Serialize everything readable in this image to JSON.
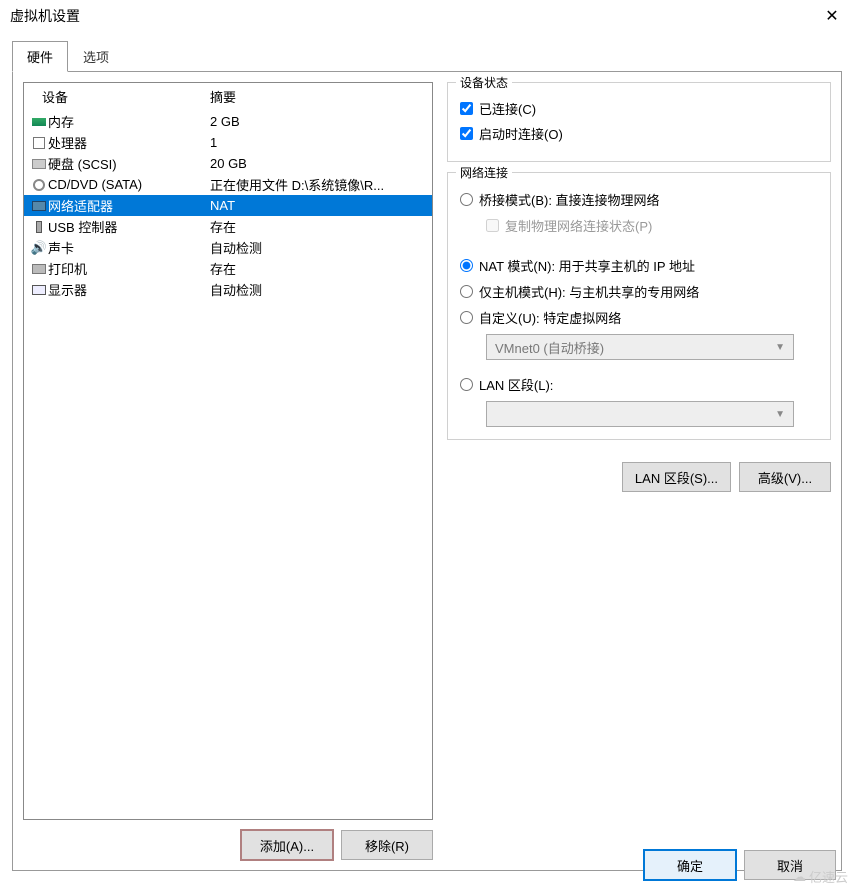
{
  "window": {
    "title": "虚拟机设置",
    "close": "✕"
  },
  "tabs": {
    "hardware": "硬件",
    "options": "选项"
  },
  "list": {
    "header_device": "设备",
    "header_summary": "摘要",
    "rows": [
      {
        "icon": "memory-icon",
        "name": "内存",
        "summary": "2 GB"
      },
      {
        "icon": "cpu-icon",
        "name": "处理器",
        "summary": "1"
      },
      {
        "icon": "disk-icon",
        "name": "硬盘 (SCSI)",
        "summary": "20 GB"
      },
      {
        "icon": "cd-icon",
        "name": "CD/DVD (SATA)",
        "summary": "正在使用文件 D:\\系统镜像\\R..."
      },
      {
        "icon": "network-icon",
        "name": "网络适配器",
        "summary": "NAT"
      },
      {
        "icon": "usb-icon",
        "name": "USB 控制器",
        "summary": "存在"
      },
      {
        "icon": "sound-icon",
        "name": "声卡",
        "summary": "自动检测"
      },
      {
        "icon": "printer-icon",
        "name": "打印机",
        "summary": "存在"
      },
      {
        "icon": "display-icon",
        "name": "显示器",
        "summary": "自动检测"
      }
    ],
    "selected_index": 4
  },
  "btn": {
    "add": "添加(A)...",
    "remove": "移除(R)"
  },
  "device_status": {
    "title": "设备状态",
    "connected": "已连接(C)",
    "connect_at_power": "启动时连接(O)"
  },
  "net": {
    "title": "网络连接",
    "bridged": "桥接模式(B): 直接连接物理网络",
    "replicate": "复制物理网络连接状态(P)",
    "nat": "NAT 模式(N): 用于共享主机的 IP 地址",
    "hostonly": "仅主机模式(H): 与主机共享的专用网络",
    "custom": "自定义(U): 特定虚拟网络",
    "custom_value": "VMnet0 (自动桥接)",
    "lan": "LAN 区段(L):",
    "lan_value": ""
  },
  "right_btns": {
    "lan_segments": "LAN 区段(S)...",
    "advanced": "高级(V)..."
  },
  "dialog": {
    "ok": "确定",
    "cancel": "取消"
  },
  "watermark": "亿速云"
}
